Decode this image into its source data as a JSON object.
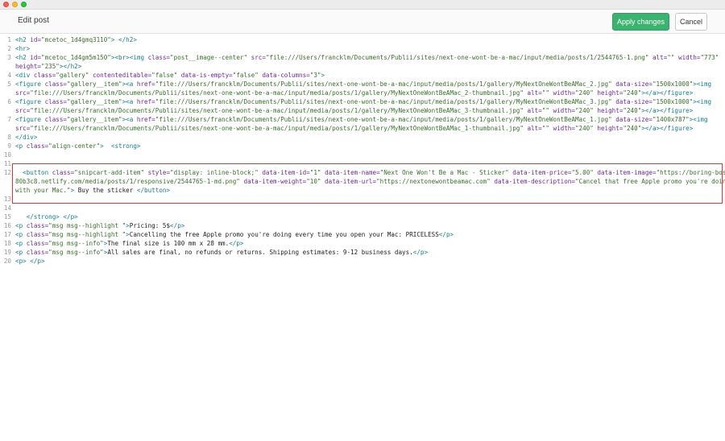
{
  "window": {
    "title": "Edit post"
  },
  "toolbar": {
    "apply_label": "Apply changes",
    "cancel_label": "Cancel"
  },
  "colors": {
    "accent": "#3bb26f",
    "highlight_border": "#e03030",
    "tag": "#177e89",
    "attribute": "#6a2b8f",
    "string": "#3b6e2e"
  },
  "editor": {
    "lines": [
      {
        "num": "1",
        "tokens": [
          [
            "tag",
            "<h2 "
          ],
          [
            "attr",
            "id="
          ],
          [
            "str",
            "\"mcetoc_1d4gmq3110\""
          ],
          [
            "tag",
            "> </h2>"
          ]
        ]
      },
      {
        "num": "2",
        "tokens": [
          [
            "tag",
            "<hr>"
          ]
        ]
      },
      {
        "num": "3",
        "tokens": [
          [
            "tag",
            "<h2 "
          ],
          [
            "attr",
            "id="
          ],
          [
            "str",
            "\"mcetoc_1d4gm5m150\""
          ],
          [
            "tag",
            "><br><img "
          ],
          [
            "attr",
            "class="
          ],
          [
            "str",
            "\"post__image--center\" "
          ],
          [
            "attr",
            "src="
          ],
          [
            "str",
            "\"file:///Users/francklm/Documents/Publii/sites/next-one-wont-be-a-mac/input/media/posts/1/2544765-1.png\" "
          ],
          [
            "attr",
            "alt="
          ],
          [
            "str",
            "\"\" "
          ],
          [
            "attr",
            "width="
          ],
          [
            "str",
            "\"773\""
          ]
        ]
      },
      {
        "num": "",
        "tokens": [
          [
            "attr",
            "height="
          ],
          [
            "str",
            "\"235\""
          ],
          [
            "tag",
            "></h2>"
          ]
        ]
      },
      {
        "num": "4",
        "tokens": [
          [
            "tag",
            "<div "
          ],
          [
            "attr",
            "class="
          ],
          [
            "str",
            "\"gallery\" "
          ],
          [
            "attr",
            "contenteditable="
          ],
          [
            "str",
            "\"false\" "
          ],
          [
            "attr",
            "data-is-empty="
          ],
          [
            "str",
            "\"false\" "
          ],
          [
            "attr",
            "data-columns="
          ],
          [
            "str",
            "\"3\""
          ],
          [
            "tag",
            ">"
          ]
        ]
      },
      {
        "num": "5",
        "tokens": [
          [
            "tag",
            "<figure "
          ],
          [
            "attr",
            "class="
          ],
          [
            "str",
            "\"gallery__item\""
          ],
          [
            "tag",
            "><a "
          ],
          [
            "attr",
            "href="
          ],
          [
            "str",
            "\"file:///Users/francklm/Documents/Publii/sites/next-one-wont-be-a-mac/input/media/posts/1/gallery/MyNextOneWontBeAMac_2.jpg\" "
          ],
          [
            "attr",
            "data-size="
          ],
          [
            "str",
            "\"1500x1000\""
          ],
          [
            "tag",
            "><img"
          ]
        ]
      },
      {
        "num": "",
        "tokens": [
          [
            "attr",
            "src="
          ],
          [
            "str",
            "\"file:///Users/francklm/Documents/Publii/sites/next-one-wont-be-a-mac/input/media/posts/1/gallery/MyNextOneWontBeAMac_2-thumbnail.jpg\" "
          ],
          [
            "attr",
            "alt="
          ],
          [
            "str",
            "\"\" "
          ],
          [
            "attr",
            "width="
          ],
          [
            "str",
            "\"240\" "
          ],
          [
            "attr",
            "height="
          ],
          [
            "str",
            "\"240\""
          ],
          [
            "tag",
            "></a></figure>"
          ]
        ]
      },
      {
        "num": "6",
        "tokens": [
          [
            "tag",
            "<figure "
          ],
          [
            "attr",
            "class="
          ],
          [
            "str",
            "\"gallery__item\""
          ],
          [
            "tag",
            "><a "
          ],
          [
            "attr",
            "href="
          ],
          [
            "str",
            "\"file:///Users/francklm/Documents/Publii/sites/next-one-wont-be-a-mac/input/media/posts/1/gallery/MyNextOneWontBeAMac_3.jpg\" "
          ],
          [
            "attr",
            "data-size="
          ],
          [
            "str",
            "\"1500x1000\""
          ],
          [
            "tag",
            "><img"
          ]
        ]
      },
      {
        "num": "",
        "tokens": [
          [
            "attr",
            "src="
          ],
          [
            "str",
            "\"file:///Users/francklm/Documents/Publii/sites/next-one-wont-be-a-mac/input/media/posts/1/gallery/MyNextOneWontBeAMac_3-thumbnail.jpg\" "
          ],
          [
            "attr",
            "alt="
          ],
          [
            "str",
            "\"\" "
          ],
          [
            "attr",
            "width="
          ],
          [
            "str",
            "\"240\" "
          ],
          [
            "attr",
            "height="
          ],
          [
            "str",
            "\"240\""
          ],
          [
            "tag",
            "></a></figure>"
          ]
        ]
      },
      {
        "num": "7",
        "tokens": [
          [
            "tag",
            "<figure "
          ],
          [
            "attr",
            "class="
          ],
          [
            "str",
            "\"gallery__item\""
          ],
          [
            "tag",
            "><a "
          ],
          [
            "attr",
            "href="
          ],
          [
            "str",
            "\"file:///Users/francklm/Documents/Publii/sites/next-one-wont-be-a-mac/input/media/posts/1/gallery/MyNextOneWontBeAMac_1.jpg\" "
          ],
          [
            "attr",
            "data-size="
          ],
          [
            "str",
            "\"1400x787\""
          ],
          [
            "tag",
            "><img"
          ]
        ]
      },
      {
        "num": "",
        "tokens": [
          [
            "attr",
            "src="
          ],
          [
            "str",
            "\"file:///Users/francklm/Documents/Publii/sites/next-one-wont-be-a-mac/input/media/posts/1/gallery/MyNextOneWontBeAMac_1-thumbnail.jpg\" "
          ],
          [
            "attr",
            "alt="
          ],
          [
            "str",
            "\"\" "
          ],
          [
            "attr",
            "width="
          ],
          [
            "str",
            "\"240\" "
          ],
          [
            "attr",
            "height="
          ],
          [
            "str",
            "\"240\""
          ],
          [
            "tag",
            "></a></figure>"
          ]
        ]
      },
      {
        "num": "8",
        "tokens": [
          [
            "tag",
            "</div>"
          ]
        ]
      },
      {
        "num": "9",
        "tokens": [
          [
            "tag",
            "<p "
          ],
          [
            "attr",
            "class="
          ],
          [
            "str",
            "\"align-center\""
          ],
          [
            "tag",
            ">  <strong>"
          ]
        ]
      },
      {
        "num": "10",
        "tokens": []
      },
      {
        "num": "11",
        "tokens": []
      },
      {
        "num": "12",
        "tokens": [
          [
            "txt",
            "  "
          ],
          [
            "tag",
            "<button "
          ],
          [
            "attr",
            "class="
          ],
          [
            "str",
            "\"snipcart-add-item\" "
          ],
          [
            "attr",
            "style="
          ],
          [
            "str",
            "\"display: inline-block;\" "
          ],
          [
            "attr",
            "data-item-id="
          ],
          [
            "str",
            "\"1\" "
          ],
          [
            "attr",
            "data-item-name="
          ],
          [
            "str",
            "\"Next One Won't Be a Mac - Sticker\" "
          ],
          [
            "attr",
            "data-item-price="
          ],
          [
            "str",
            "\"5.00\" "
          ],
          [
            "attr",
            "data-item-image="
          ],
          [
            "str",
            "\"https://boring-bose-"
          ]
        ]
      },
      {
        "num": "",
        "tokens": [
          [
            "str",
            "80b3c8.netlify.com/media/posts/1/responsive/2544765-1-md.png\" "
          ],
          [
            "attr",
            "data-item-weight="
          ],
          [
            "str",
            "\"10\" "
          ],
          [
            "attr",
            "data-item-url="
          ],
          [
            "str",
            "\"https://nextonewontbeamac.com\" "
          ],
          [
            "attr",
            "data-item-description="
          ],
          [
            "str",
            "\"Cancel that free Apple promo you're doing"
          ]
        ]
      },
      {
        "num": "",
        "tokens": [
          [
            "str",
            "with your Mac.\""
          ],
          [
            "tag",
            ">"
          ],
          [
            "txt",
            " Buy the sticker "
          ],
          [
            "tag",
            "</button>"
          ]
        ]
      },
      {
        "num": "13",
        "tokens": []
      },
      {
        "num": "14",
        "tokens": []
      },
      {
        "num": "15",
        "tokens": [
          [
            "txt",
            "   "
          ],
          [
            "tag",
            "</strong> </p>"
          ]
        ]
      },
      {
        "num": "16",
        "tokens": [
          [
            "tag",
            "<p "
          ],
          [
            "attr",
            "class="
          ],
          [
            "str",
            "\"msg msg--highlight \""
          ],
          [
            "tag",
            ">"
          ],
          [
            "txt",
            "Pricing: 5$"
          ],
          [
            "tag",
            "</p>"
          ]
        ]
      },
      {
        "num": "17",
        "tokens": [
          [
            "tag",
            "<p "
          ],
          [
            "attr",
            "class="
          ],
          [
            "str",
            "\"msg msg--highlight \""
          ],
          [
            "tag",
            ">"
          ],
          [
            "txt",
            "Cancelling the free Apple promo you're doing every time you open your Mac: PRICELESS"
          ],
          [
            "tag",
            "</p>"
          ]
        ]
      },
      {
        "num": "18",
        "tokens": [
          [
            "tag",
            "<p "
          ],
          [
            "attr",
            "class="
          ],
          [
            "str",
            "\"msg msg--info\""
          ],
          [
            "tag",
            ">"
          ],
          [
            "txt",
            "The final size is 100 mm x 28 mm."
          ],
          [
            "tag",
            "</p>"
          ]
        ]
      },
      {
        "num": "19",
        "tokens": [
          [
            "tag",
            "<p "
          ],
          [
            "attr",
            "class="
          ],
          [
            "str",
            "\"msg msg--info\""
          ],
          [
            "tag",
            ">"
          ],
          [
            "txt",
            "All sales are final, no refunds or returns. Shipping estimates: 9-12 business days."
          ],
          [
            "tag",
            "</p>"
          ]
        ]
      },
      {
        "num": "20",
        "tokens": [
          [
            "tag",
            "<p> </p>"
          ]
        ]
      }
    ]
  }
}
